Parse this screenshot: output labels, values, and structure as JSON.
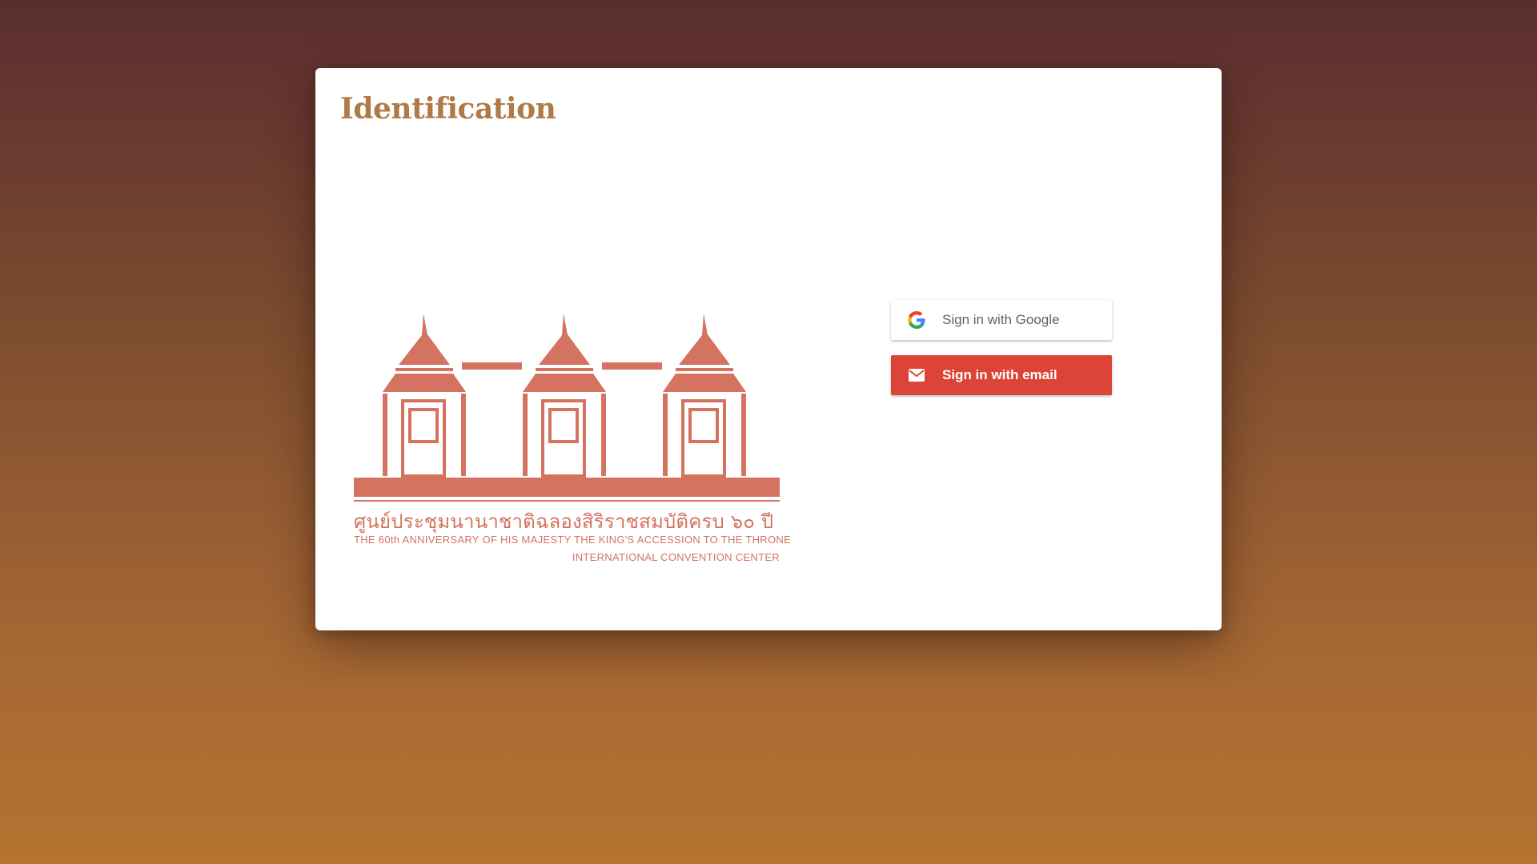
{
  "page": {
    "title": "Identification"
  },
  "logo": {
    "thai_text": "ศูนย์ประชุมนานาชาติฉลองสิริราชสมบัติครบ ๖๐ ปี",
    "english_line1": "THE 60th ANNIVERSARY OF HIS MAJESTY THE KING'S ACCESSION TO THE THRONE",
    "english_line2": "INTERNATIONAL CONVENTION CENTER"
  },
  "signin": {
    "google_label": "Sign in with Google",
    "email_label": "Sign in with email"
  },
  "colors": {
    "title": "#b07a47",
    "logo": "#d4735f",
    "email_button": "#db4437",
    "google_button": "#ffffff"
  },
  "icons": {
    "google": "google-icon",
    "email": "mail-icon"
  }
}
